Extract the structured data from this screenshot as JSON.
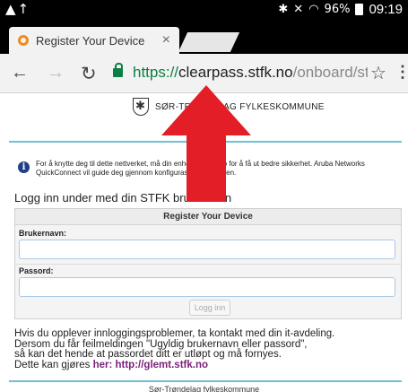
{
  "status_bar": {
    "left_icons": [
      "warning-icon",
      "upload-icon"
    ],
    "right_icons": [
      "bluetooth-icon",
      "mute-icon",
      "wifi-icon"
    ],
    "battery": "96%",
    "time": "09:19"
  },
  "tab": {
    "title": "Register Your Device",
    "close": "×"
  },
  "address": {
    "scheme": "https://",
    "host": "clearpass.stfk.no",
    "path": "/onboard/stfk_"
  },
  "page": {
    "org_name": "SØR-TRØNDELAG FYLKESKOMMUNE",
    "info_text": "For å knytte deg til dette nettverket, må din enhet settes opp for å få ut bedre sikkerhet. Aruba Networks QuickConnect vil guide deg gjennom konfigurasjonsprosessen.",
    "login_heading": "Logg inn under med din STFK brukernavn",
    "form": {
      "title": "Register Your Device",
      "username_label": "Brukernavn:",
      "password_label": "Passord:",
      "submit": "Logg inn"
    },
    "help": {
      "line1": "Hvis du opplever innloggingsproblemer, ta kontakt med din it-avdeling.",
      "line2": "Dersom du får feilmeldingen \"Ugyldig brukernavn eller passord\",",
      "line3": "så kan det hende at passordet ditt er utløpt og må fornyes.",
      "line4_prefix": "Dette kan gjøres ",
      "line4_link": "her: http://glemt.stfk.no"
    },
    "footer": "Sør-Trøndelag fylkeskommune"
  },
  "colors": {
    "accent_green": "#0b8043",
    "rule_blue": "#6fbfd9",
    "link_purple": "#7a1f7a",
    "arrow_red": "#e41e26"
  }
}
